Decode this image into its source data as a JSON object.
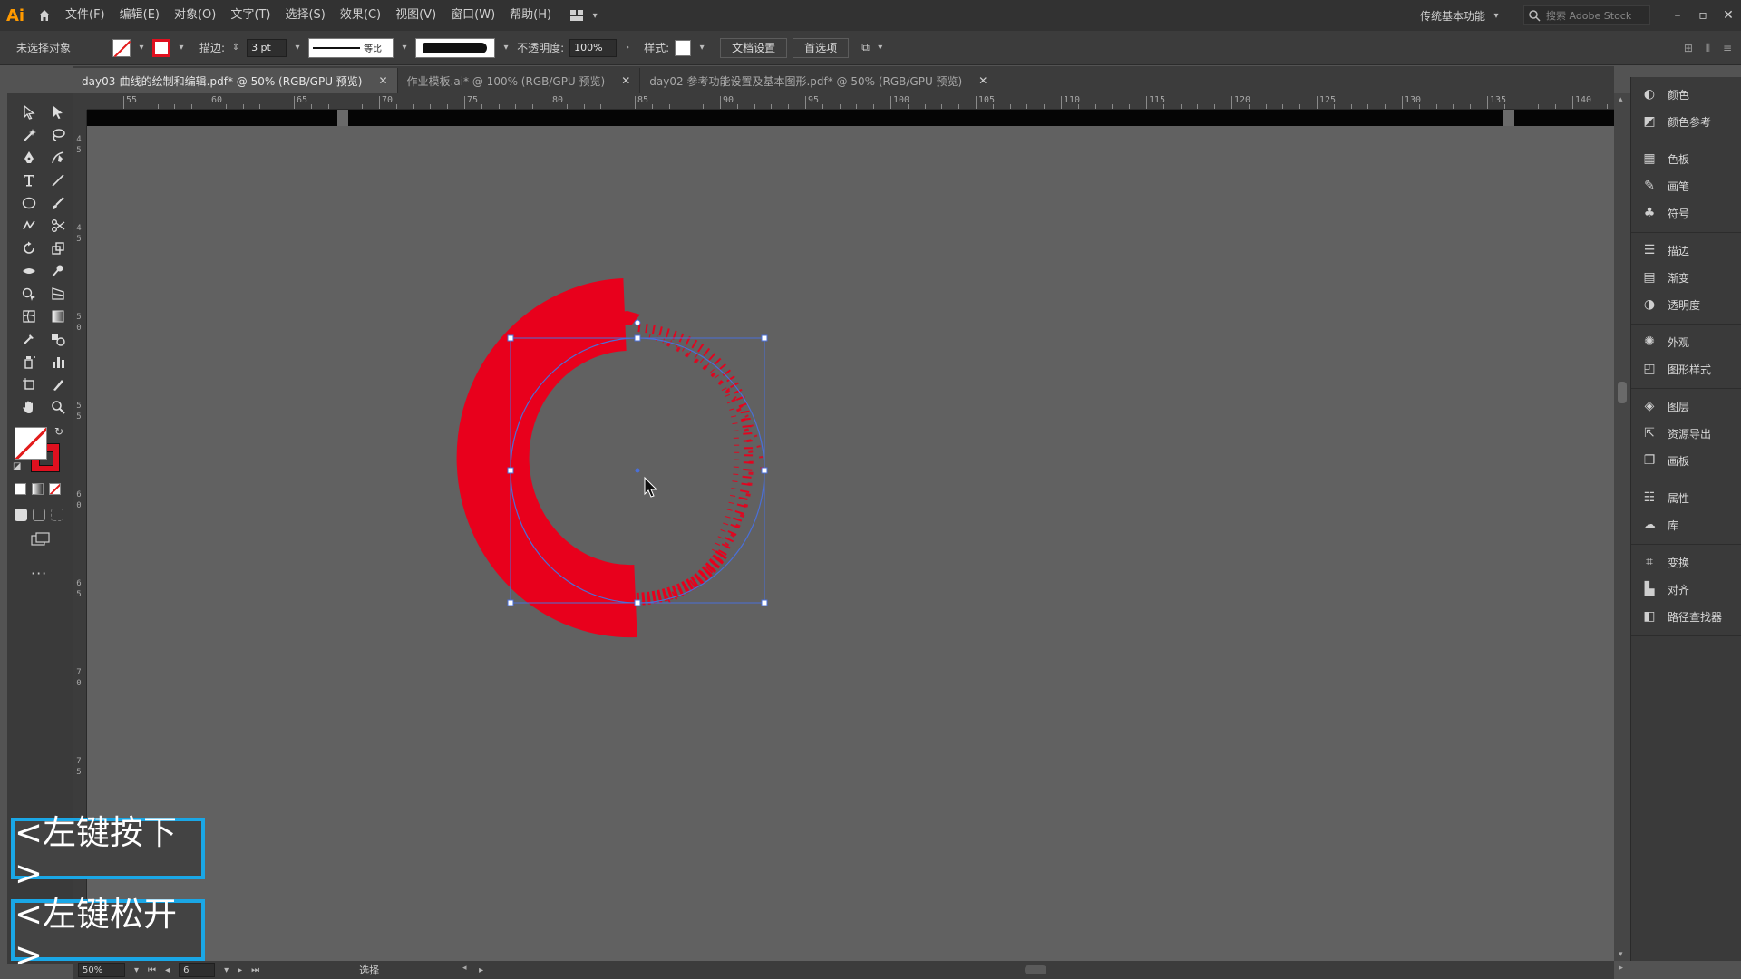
{
  "app": {
    "logo": "Ai",
    "menu": [
      "文件(F)",
      "编辑(E)",
      "对象(O)",
      "文字(T)",
      "选择(S)",
      "效果(C)",
      "视图(V)",
      "窗口(W)",
      "帮助(H)"
    ],
    "workspace": "传统基本功能",
    "search_placeholder": "搜索 Adobe Stock"
  },
  "control_bar": {
    "selection_state": "未选择对象",
    "stroke_label": "描边:",
    "stroke_weight": "3 pt",
    "stroke_profile": "等比",
    "opacity_label": "不透明度:",
    "opacity_value": "100%",
    "style_label": "样式:",
    "doc_setup_button": "文档设置",
    "prefs_button": "首选项"
  },
  "tabs": [
    {
      "label": "day03-曲线的绘制和编辑.pdf* @ 50% (RGB/GPU 预览)",
      "active": true
    },
    {
      "label": "作业模板.ai* @ 100% (RGB/GPU 预览)",
      "active": false
    },
    {
      "label": "day02 参考功能设置及基本图形.pdf* @ 50% (RGB/GPU 预览)",
      "active": false
    }
  ],
  "ruler": {
    "top_ticks": [
      "55",
      "60",
      "65",
      "70",
      "75",
      "80",
      "85",
      "90",
      "95",
      "100",
      "105",
      "110",
      "115",
      "120",
      "125",
      "130",
      "135",
      "140"
    ],
    "left_ticks": [
      "4",
      "5",
      "4",
      "5",
      "5",
      "0",
      "5",
      "5",
      "6",
      "0",
      "6",
      "5",
      "7",
      "0",
      "7",
      "5"
    ]
  },
  "status": {
    "zoom": "50%",
    "artboard": "6",
    "tool": "选择"
  },
  "right_panels": [
    [
      "颜色",
      "颜色参考"
    ],
    [
      "色板",
      "画笔",
      "符号"
    ],
    [
      "描边",
      "渐变",
      "透明度"
    ],
    [
      "外观",
      "图形样式"
    ],
    [
      "图层",
      "资源导出",
      "画板"
    ],
    [
      "属性",
      "库"
    ],
    [
      "变换",
      "对齐",
      "路径查找器"
    ]
  ],
  "captions": {
    "mouse_down": "<左键按下>",
    "mouse_up": "<左键松开>"
  },
  "colors": {
    "brush_stroke": "#e8001c",
    "selection": "#4a6fd8",
    "caption_border": "#1aa7e6"
  }
}
